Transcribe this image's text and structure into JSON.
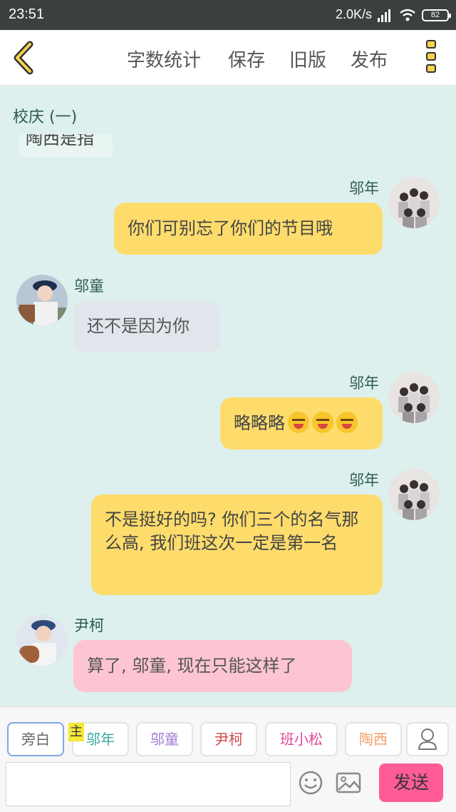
{
  "status_bar": {
    "time": "23:51",
    "network_speed": "2.0K/s",
    "battery": "82"
  },
  "top_bar": {
    "word_count": "字数统计",
    "save": "保存",
    "old_version": "旧版",
    "publish": "发布"
  },
  "chapter_title": "校庆 (一)",
  "cut_message": "陶西是指",
  "messages": [
    {
      "speaker": "邬年",
      "text": "你们可别忘了你们的节目哦"
    },
    {
      "speaker": "邬童",
      "text": "还不是因为你"
    },
    {
      "speaker": "邬年",
      "text": "略略略"
    },
    {
      "speaker": "邬年",
      "text": "不是挺好的吗? 你们三个的名气那么高, 我们班这次一定是第一名"
    },
    {
      "speaker": "尹柯",
      "text": "算了, 邬童, 现在只能这样了"
    }
  ],
  "roles": {
    "narration": "旁白",
    "host_badge": "主",
    "items": [
      "邬年",
      "邬童",
      "尹柯",
      "班小松",
      "陶西"
    ],
    "colors": [
      "#39a8a0",
      "#a27bd0",
      "#d24b4b",
      "#e0489a",
      "#f1a068"
    ]
  },
  "input": {
    "placeholder": ""
  },
  "send_label": "发送",
  "colors": {
    "yellow_bubble": "#fddc6c",
    "gray_bubble": "#e1e6ec",
    "pink_bubble": "#fdc5d3",
    "send_button": "#ff5c97",
    "background": "#ddf0ee"
  }
}
